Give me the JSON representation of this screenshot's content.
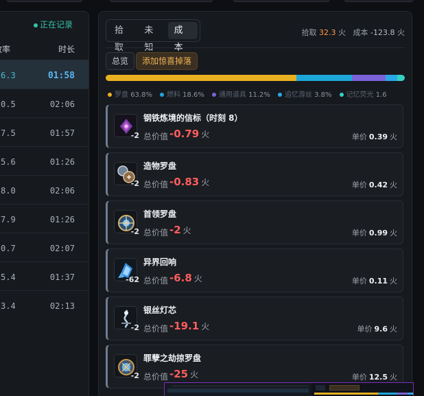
{
  "left_panel": {
    "recording_status": "正在记录",
    "columns": {
      "rate_header": "效率",
      "duration_header": "时长"
    },
    "rows": [
      {
        "rate": "6.3",
        "duration": "01:58",
        "active": true
      },
      {
        "rate": "0.5",
        "duration": "02:06"
      },
      {
        "rate": "7.5",
        "duration": "01:57"
      },
      {
        "rate": "5.6",
        "duration": "01:26"
      },
      {
        "rate": "8.0",
        "duration": "02:06"
      },
      {
        "rate": "7.9",
        "duration": "01:26"
      },
      {
        "rate": "0.7",
        "duration": "02:07"
      },
      {
        "rate": "5.4",
        "duration": "01:37"
      },
      {
        "rate": "3.4",
        "duration": "02:13"
      }
    ]
  },
  "right_panel": {
    "tabs": [
      {
        "label": "拾取",
        "active": false
      },
      {
        "label": "未知",
        "active": false
      },
      {
        "label": "成本",
        "active": true
      }
    ],
    "summary": {
      "pick_label": "拾取",
      "pick_value": "32.3",
      "pick_unit": "火",
      "cost_label": "成本",
      "cost_value": "-123.8",
      "cost_unit": "火"
    },
    "buttons": {
      "total": "总览",
      "add_surprise": "添加惊喜掉落"
    },
    "distribution": [
      {
        "name": "罗盘",
        "percent": 63.8,
        "percent_text": "63.8%",
        "color": "#e8b020"
      },
      {
        "name": "燃料",
        "percent": 18.6,
        "percent_text": "18.6%",
        "color": "#1da6d8"
      },
      {
        "name": "通用道具",
        "percent": 11.2,
        "percent_text": "11.2%",
        "color": "#7b62d8"
      },
      {
        "name": "追忆游丝",
        "percent": 3.8,
        "percent_text": "3.8%",
        "color": "#2aa8e6"
      },
      {
        "name": "记忆荧光",
        "percent": 2.6,
        "percent_text": "1.6",
        "color": "#34d1c3"
      }
    ],
    "items": [
      {
        "name": "钢铁炼境的信标（时刻 8）",
        "icon": "beacon-icon",
        "qty": "-2",
        "total_label": "总价值",
        "total_value": "-0.79",
        "unit_label": "单价",
        "unit_value": "0.39",
        "currency": "火"
      },
      {
        "name": "造物罗盘",
        "icon": "creation-compass-icon",
        "qty": "-2",
        "total_label": "总价值",
        "total_value": "-0.83",
        "unit_label": "单价",
        "unit_value": "0.42",
        "currency": "火"
      },
      {
        "name": "首领罗盘",
        "icon": "boss-compass-icon",
        "qty": "-2",
        "total_label": "总价值",
        "total_value": "-2",
        "unit_label": "单价",
        "unit_value": "0.99",
        "currency": "火"
      },
      {
        "name": "异界回响",
        "icon": "otherworld-echo-icon",
        "qty": "-62",
        "total_label": "总价值",
        "total_value": "-6.8",
        "unit_label": "单价",
        "unit_value": "0.11",
        "currency": "火"
      },
      {
        "name": "银丝灯芯",
        "icon": "silver-wick-icon",
        "qty": "-2",
        "total_label": "总价值",
        "total_value": "-19.1",
        "unit_label": "单价",
        "unit_value": "9.6",
        "currency": "火"
      },
      {
        "name": "罪孽之劫掠罗盘",
        "icon": "sin-plunder-compass-icon",
        "qty": "-2",
        "total_label": "总价值",
        "total_value": "-25",
        "unit_label": "单价",
        "unit_value": "12.5",
        "currency": "火"
      }
    ]
  }
}
